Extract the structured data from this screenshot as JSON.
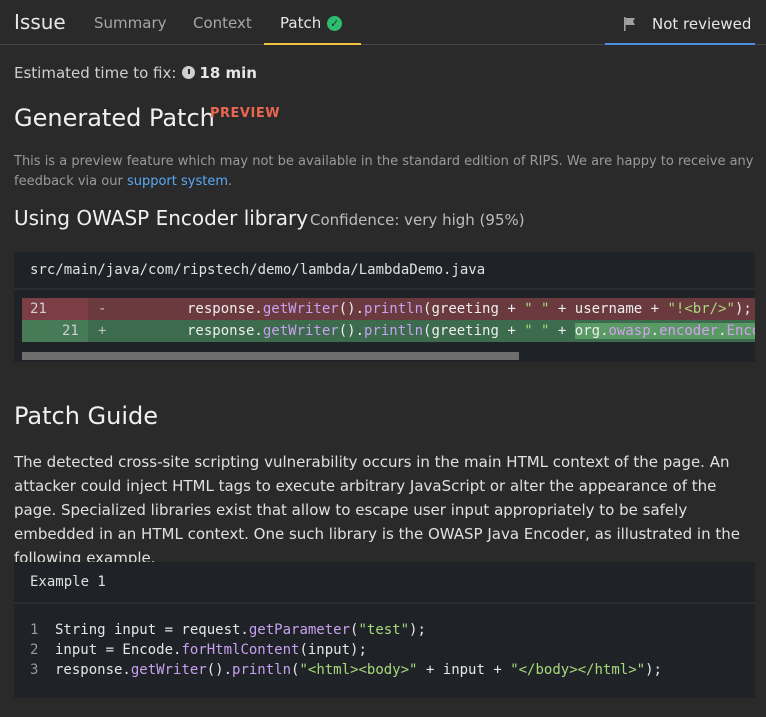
{
  "tabs": {
    "title": "Issue",
    "summary": "Summary",
    "context": "Context",
    "patch": "Patch",
    "review_status": "Not reviewed"
  },
  "estimate": {
    "label": "Estimated time to fix:",
    "value": "18 min"
  },
  "generated_patch": {
    "heading": "Generated Patch",
    "badge": "PREVIEW",
    "note_text": "This is a preview feature which may not be available in the standard edition of RIPS. We are happy to receive any feedback via our ",
    "note_link": "support system",
    "note_end": "."
  },
  "fix": {
    "heading": "Using OWASP Encoder library",
    "confidence": "Confidence: very high (95%)",
    "file_path": "src/main/java/com/ripstech/demo/lambda/LambdaDemo.java",
    "diff": [
      {
        "old_line": "21",
        "new_line": "",
        "sign": "-",
        "tokens": [
          {
            "t": "response.",
            "c": ""
          },
          {
            "t": "getWriter",
            "c": "fn"
          },
          {
            "t": "().",
            "c": ""
          },
          {
            "t": "println",
            "c": "fn"
          },
          {
            "t": "(greeting + ",
            "c": ""
          },
          {
            "t": "\" \"",
            "c": "str"
          },
          {
            "t": " + username + ",
            "c": ""
          },
          {
            "t": "\"!<br/>\"",
            "c": "str"
          },
          {
            "t": ");",
            "c": ""
          }
        ]
      },
      {
        "old_line": "",
        "new_line": "21",
        "sign": "+",
        "tokens": [
          {
            "t": "response.",
            "c": ""
          },
          {
            "t": "getWriter",
            "c": "fn"
          },
          {
            "t": "().",
            "c": ""
          },
          {
            "t": "println",
            "c": "fn"
          },
          {
            "t": "(greeting + ",
            "c": ""
          },
          {
            "t": "\" \"",
            "c": "str"
          },
          {
            "t": " + ",
            "c": ""
          },
          {
            "t": "org.",
            "c": "hl"
          },
          {
            "t": "owasp",
            "c": "hl pkg"
          },
          {
            "t": ".",
            "c": "hl"
          },
          {
            "t": "encoder",
            "c": "hl pkg"
          },
          {
            "t": ".",
            "c": "hl"
          },
          {
            "t": "Encode",
            "c": "hl pkg"
          }
        ]
      }
    ]
  },
  "guide": {
    "heading": "Patch Guide",
    "text": "The detected cross-site scripting vulnerability occurs in the main HTML context of the page. An attacker could inject HTML tags to execute arbitrary JavaScript or alter the appearance of the page. Specialized libraries exist that allow to escape user input appropriately to be safely embedded in an HTML context. One such library is the OWASP Java Encoder, as illustrated in the following example."
  },
  "example": {
    "title": "Example 1",
    "lines": [
      {
        "num": "1",
        "tokens": [
          {
            "t": "String input = request.",
            "c": ""
          },
          {
            "t": "getParameter",
            "c": "fn"
          },
          {
            "t": "(",
            "c": ""
          },
          {
            "t": "\"test\"",
            "c": "str"
          },
          {
            "t": ");",
            "c": ""
          }
        ]
      },
      {
        "num": "2",
        "tokens": [
          {
            "t": "input = Encode.",
            "c": ""
          },
          {
            "t": "forHtmlContent",
            "c": "fn"
          },
          {
            "t": "(input);",
            "c": ""
          }
        ]
      },
      {
        "num": "3",
        "tokens": [
          {
            "t": "response.",
            "c": ""
          },
          {
            "t": "getWriter",
            "c": "fn"
          },
          {
            "t": "().",
            "c": ""
          },
          {
            "t": "println",
            "c": "fn"
          },
          {
            "t": "(",
            "c": ""
          },
          {
            "t": "\"<html><body>\"",
            "c": "str"
          },
          {
            "t": " + input + ",
            "c": ""
          },
          {
            "t": "\"</body></html>\"",
            "c": "str"
          },
          {
            "t": ");",
            "c": ""
          }
        ]
      }
    ]
  }
}
